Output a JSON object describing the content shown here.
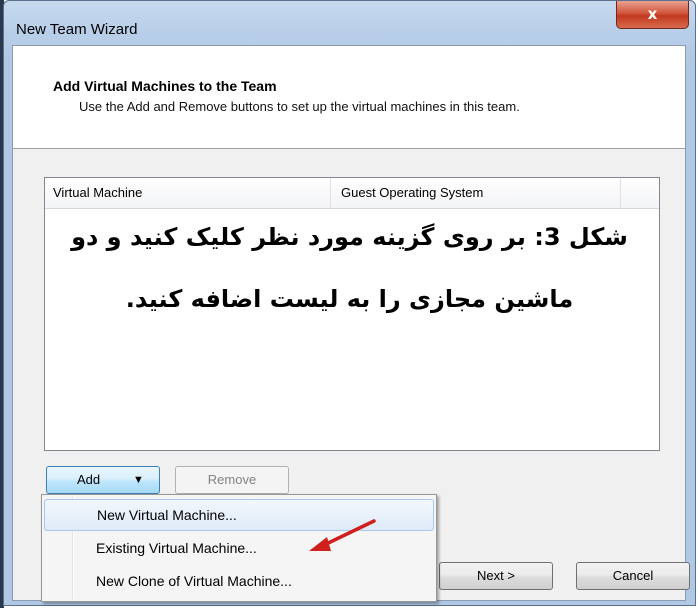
{
  "window": {
    "title": "New Team Wizard",
    "close_glyph": "x"
  },
  "header": {
    "title": "Add Virtual Machines to the Team",
    "description": "Use the Add and Remove buttons to set up the virtual machines in this team."
  },
  "list": {
    "columns": [
      "Virtual Machine",
      "Guest Operating System",
      ""
    ]
  },
  "caption": {
    "line1": "شکل 3: بر روی گزینه  مورد نظر کلیک کنید و دو",
    "line2": "ماشین مجازی را به لیست اضافه کنید."
  },
  "buttons": {
    "add": "Add",
    "add_arrow": "▼",
    "remove": "Remove",
    "next": "Next >",
    "cancel": "Cancel"
  },
  "add_menu": {
    "items": [
      "New Virtual Machine...",
      "Existing Virtual Machine...",
      "New Clone of Virtual Machine..."
    ]
  },
  "colors": {
    "annotation_arrow": "#d0201e",
    "close_button": "#c8452a"
  }
}
